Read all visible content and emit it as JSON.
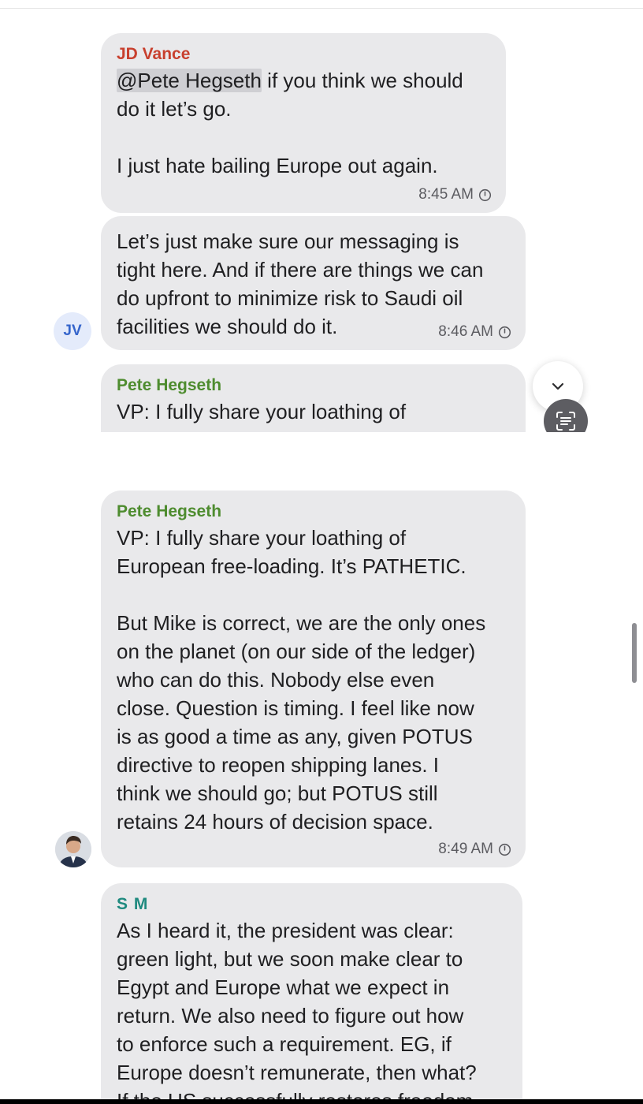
{
  "messages": [
    {
      "sender": "JD Vance",
      "mention": "@Pete Hegseth",
      "lines": [
        " if you think we should",
        "do it let’s go.",
        "",
        "I just hate bailing Europe out again."
      ],
      "time": "8:45 AM"
    },
    {
      "lines": [
        "Let’s just make sure our messaging is",
        "tight here. And if there are things we can",
        "do upfront to minimize risk to Saudi oil",
        "facilities we should do it."
      ],
      "time": "8:46 AM",
      "avatar_initials": "JV"
    },
    {
      "sender": "Pete Hegseth",
      "lines": [
        "VP: I fully share your loathing of",
        "European free-loading. It’s PATHETIC."
      ]
    },
    {
      "sender": "Pete Hegseth",
      "lines": [
        "VP: I fully share your loathing of",
        "European free-loading. It’s PATHETIC.",
        "",
        "But Mike is correct, we are the only ones",
        "on the planet (on our side of the ledger)",
        "who can do this. Nobody else even",
        "close. Question is timing. I feel like now",
        "is as good a time as any, given POTUS",
        "directive to reopen shipping lanes. I",
        "think we should go; but POTUS still",
        "retains 24 hours of decision space."
      ],
      "time": "8:49 AM"
    },
    {
      "sender": "S M",
      "lines": [
        "As I heard it, the president was clear:",
        "green light, but we soon make clear to",
        "Egypt and Europe what we expect in",
        "return. We also need to figure out how",
        "to enforce such a requirement. EG, if",
        "Europe doesn’t remunerate, then what?",
        "If the US successfully restores freedom"
      ]
    }
  ],
  "icons": {
    "clock": "clock-icon",
    "scroll_down": "chevron-down-icon",
    "scan": "scan-text-icon",
    "avatar": "profile-photo-avatar"
  },
  "colors": {
    "bubble": "#e9e9eb",
    "sender_jd": "#c8402e",
    "sender_pete": "#4e8c2f",
    "sender_sm": "#1f8a7f",
    "avatar_jv_text": "#3565cc"
  }
}
